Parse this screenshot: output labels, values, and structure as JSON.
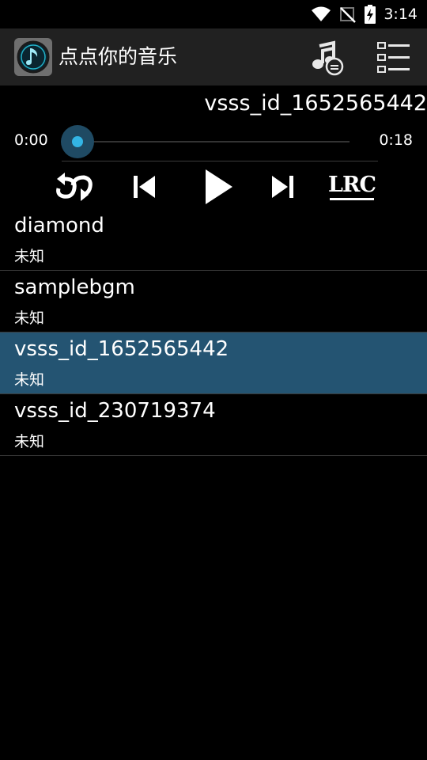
{
  "status_bar": {
    "time": "3:14"
  },
  "app_bar": {
    "title": "点点你的音乐"
  },
  "player": {
    "now_playing": "vsss_id_1652565442",
    "current_time": "0:00",
    "total_time": "0:18",
    "progress": 0.0,
    "lrc_label": "LRC"
  },
  "songs": [
    {
      "title": "diamond",
      "artist": "未知",
      "selected": false
    },
    {
      "title": "samplebgm",
      "artist": "未知",
      "selected": false
    },
    {
      "title": "vsss_id_1652565442",
      "artist": "未知",
      "selected": true
    },
    {
      "title": "vsss_id_230719374",
      "artist": "未知",
      "selected": false
    }
  ],
  "colors": {
    "app_bar_bg": "#212121",
    "selected_row_bg": "#245472",
    "accent": "#33b5e5"
  }
}
